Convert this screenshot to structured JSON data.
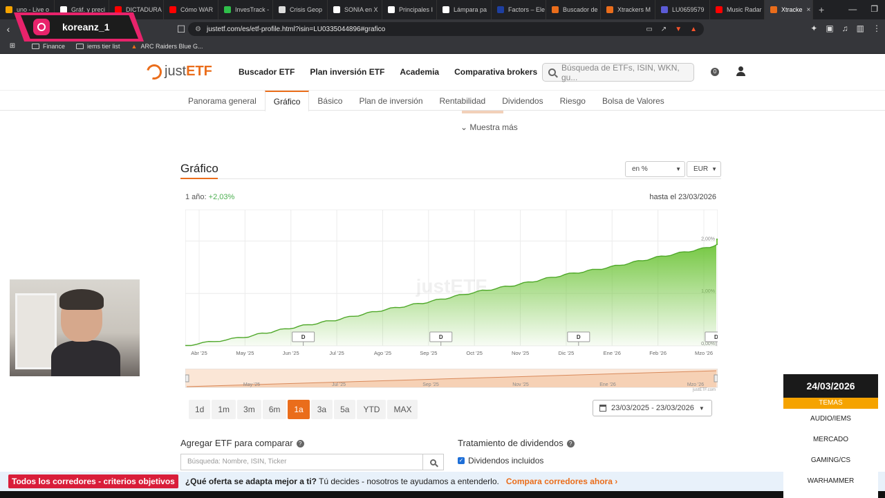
{
  "browser": {
    "tabs": [
      {
        "label": "uno - Live o",
        "color": "#f5a300"
      },
      {
        "label": "Gráf. y preci",
        "color": "#ffffff"
      },
      {
        "label": "DICTADURA",
        "color": "#ff0000"
      },
      {
        "label": "Cómo WAR",
        "color": "#ff0000"
      },
      {
        "label": "InvesTrack -",
        "color": "#2fbf4a"
      },
      {
        "label": "Crisis Geop",
        "color": "#dddddd"
      },
      {
        "label": "SONIA en X",
        "color": "#ffffff"
      },
      {
        "label": "Principales I",
        "color": "#ffffff"
      },
      {
        "label": "Lámpara pa",
        "color": "#ffffff"
      },
      {
        "label": "Factors – Ele",
        "color": "#1e3fa0"
      },
      {
        "label": "Buscador de",
        "color": "#ea6d1b"
      },
      {
        "label": "Xtrackers M",
        "color": "#ea6d1b"
      },
      {
        "label": "LU0659579",
        "color": "#5b5bd6"
      },
      {
        "label": "Music Radar",
        "color": "#ff0000"
      },
      {
        "label": "Xtracke",
        "color": "#ea6d1b",
        "active": true
      }
    ],
    "url": "justetf.com/es/etf-profile.html?isin=LU0335044896#grafico",
    "bookmarks": [
      "Finance",
      "iems tier list",
      "ARC Raiders Blue G..."
    ]
  },
  "overlay": {
    "instagram_handle": "koreanz_1",
    "topics_date": "24/03/2026",
    "topics_header": "TEMAS",
    "topics": [
      "AUDIO/IEMS",
      "MERCADO",
      "GAMING/CS",
      "WARHAMMER"
    ]
  },
  "site": {
    "logo_just": "just",
    "logo_etf": "ETF",
    "nav": [
      "Buscador ETF",
      "Plan inversión ETF",
      "Academia",
      "Comparativa brokers"
    ],
    "search_placeholder": "Búsqueda de ETFs, ISIN, WKN, gu...",
    "counter": "0",
    "subnav": [
      "Panorama general",
      "Gráfico",
      "Básico",
      "Plan de inversión",
      "Rentabilidad",
      "Dividendos",
      "Riesgo",
      "Bolsa de Valores"
    ],
    "subnav_active": 1,
    "show_more": "Muestra más"
  },
  "chart_section": {
    "title": "Gráfico",
    "unit_select": "en %",
    "currency_select": "EUR",
    "period_label": "1 año:",
    "period_value": "+2,03%",
    "until_label": "hasta el 23/03/2026",
    "ranges": [
      "1d",
      "1m",
      "3m",
      "6m",
      "1a",
      "3a",
      "5a",
      "YTD",
      "MAX"
    ],
    "active_range": "1a",
    "date_range": "23/03/2025 - 23/03/2026",
    "credit": "justETF.com"
  },
  "chart_data": {
    "type": "area",
    "title": "",
    "x_labels": [
      "Abr '25",
      "May '25",
      "Jun '25",
      "Jul '25",
      "Ago '25",
      "Sep '25",
      "Oct '25",
      "Nov '25",
      "Dic '25",
      "Ene '26",
      "Feb '26",
      "Mzo '26"
    ],
    "y_ticks": [
      "0,00%",
      "1,00%",
      "2,00%"
    ],
    "ylim": [
      0,
      2.6
    ],
    "watermark": "justETF",
    "dividend_marker_label": "D",
    "dividend_markers_at_month": [
      2.3,
      5.3,
      8.3,
      11.3
    ],
    "series": [
      {
        "values_x_month": [
          0.0,
          1.0,
          2.0,
          3.0,
          4.0,
          5.0,
          6.0,
          7.0,
          8.0,
          9.0,
          10.0,
          11.0,
          11.8
        ],
        "values": [
          0.0,
          0.17,
          0.33,
          0.5,
          0.67,
          0.84,
          1.01,
          1.18,
          1.35,
          1.51,
          1.68,
          1.86,
          2.03
        ]
      }
    ],
    "navigator_labels": [
      "May '25",
      "Jul '25",
      "Sep '25",
      "Nov '25",
      "Ene '26",
      "Mzo '26"
    ],
    "grid": true,
    "color": "#6fc53a"
  },
  "compare": {
    "title": "Agregar ETF para comparar",
    "input_placeholder": "Búsqueda: Nombre, ISIN, Ticker",
    "dividends_title": "Tratamiento de dividendos",
    "dividends_option": "Dividendos incluidos"
  },
  "banner": {
    "badge": "Todos los corredores - criterios objetivos",
    "question_bold": "¿Qué oferta se adapta mejor a ti?",
    "question_rest": " Tú decides - nosotros te ayudamos a entenderlo.",
    "cta": "Compara corredores ahora ›"
  }
}
